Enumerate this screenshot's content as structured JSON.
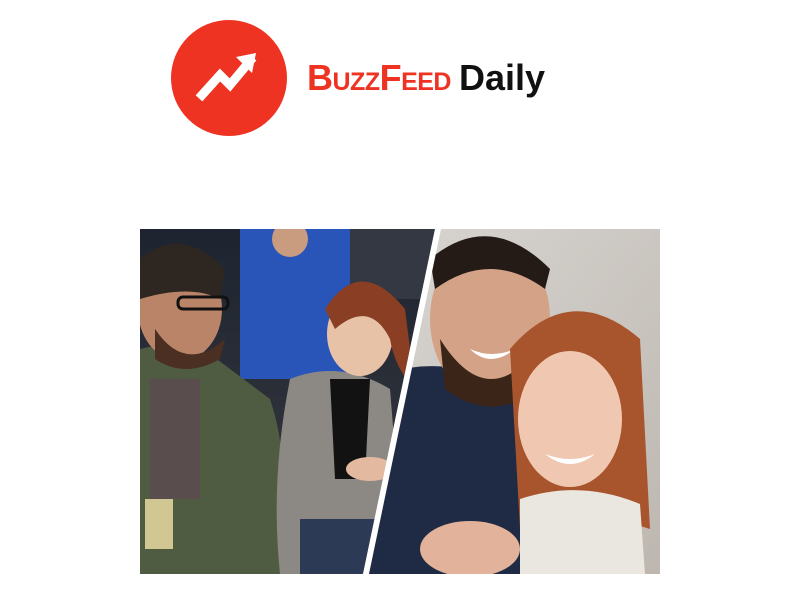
{
  "header": {
    "brand_text": "BuzzFeed",
    "suffix_text": "Daily",
    "logo_icon": "trending-arrow-icon",
    "brand_color": "#ee3322"
  },
  "hero": {
    "left_photo_icon": "courtside-couple-photo",
    "right_photo_icon": "selfie-couple-photo"
  }
}
